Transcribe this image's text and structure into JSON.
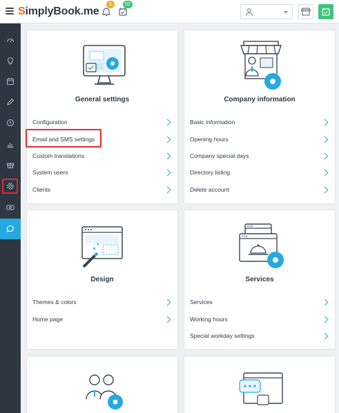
{
  "app": {
    "logo_prefix": "S",
    "logo_name": "implyBook",
    "logo_suffix": ".me",
    "notifications_badge": "5",
    "bookings_badge": "52",
    "accent_color": "#25a9e0",
    "brand_color": "#f26a23"
  },
  "sidebar": {
    "items": [
      {
        "icon": "dashboard-icon"
      },
      {
        "icon": "lightbulb-icon"
      },
      {
        "icon": "calendar-icon"
      },
      {
        "icon": "pencil-icon"
      },
      {
        "icon": "clock-icon"
      },
      {
        "icon": "bar-chart-icon"
      },
      {
        "icon": "gift-icon"
      },
      {
        "icon": "gear-icon"
      },
      {
        "icon": "money-icon"
      },
      {
        "icon": "chat-icon"
      }
    ]
  },
  "cards": {
    "general": {
      "title": "General settings",
      "links": [
        "Configuration",
        "Email and SMS settings",
        "Custom translations",
        "System users",
        "Clients"
      ]
    },
    "company": {
      "title": "Company information",
      "links": [
        "Basic information",
        "Opening hours",
        "Company special days",
        "Directory listing",
        "Delete account"
      ]
    },
    "design": {
      "title": "Design",
      "links": [
        "Themes & colors",
        "Home page"
      ]
    },
    "services": {
      "title": "Services",
      "links": [
        "Services",
        "Working hours",
        "Special workday settings"
      ]
    }
  }
}
